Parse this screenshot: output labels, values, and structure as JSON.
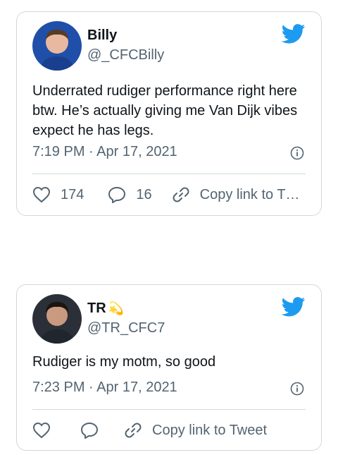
{
  "tweets": [
    {
      "author_name": "Billy",
      "author_handle": "@_CFCBilly",
      "text": "Underrated rudiger performance right here btw. He’s actually giving me Van Dijk vibes expect he has legs.",
      "timestamp": "7:19 PM · Apr 17, 2021",
      "like_count": "174",
      "reply_count": "16",
      "copy_link_label": "Copy link to T…"
    },
    {
      "author_name": "TR",
      "author_emoji": "💫",
      "author_handle": "@TR_CFC7",
      "text": "Rudiger is my motm, so good",
      "timestamp": "7:23 PM · Apr 17, 2021",
      "copy_link_label": "Copy link to Tweet"
    }
  ],
  "colors": {
    "twitter_blue": "#1d9bf0",
    "secondary_text": "#536471",
    "border": "#cfd9de"
  },
  "icons": [
    "twitter-bird-icon",
    "info-icon",
    "heart-icon",
    "reply-icon",
    "link-icon"
  ]
}
